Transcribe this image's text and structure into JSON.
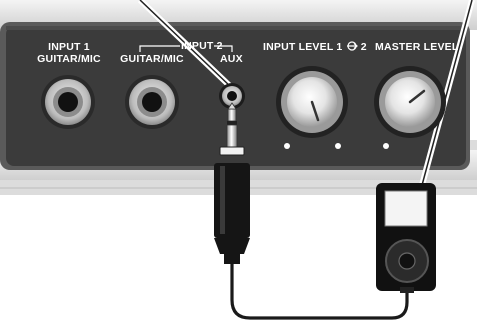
{
  "panel": {
    "input1": {
      "line1": "INPUT 1",
      "line2": "GUITAR/MIC"
    },
    "input2": {
      "group": "INPUT 2",
      "jack": "GUITAR/MIC",
      "aux": "AUX"
    },
    "input_level": {
      "label": "INPUT LEVEL 1",
      "suffix": "2"
    },
    "master_level": {
      "label": "MASTER LEVEL"
    }
  },
  "colors": {
    "panel": "#3b3b3b",
    "chassis": "#e6e6e6",
    "cable": "#1a1a1a",
    "player_body": "#111111",
    "player_screen": "#f4f4f4"
  },
  "icons": {
    "input_level_link": "link-arrow-icon"
  }
}
